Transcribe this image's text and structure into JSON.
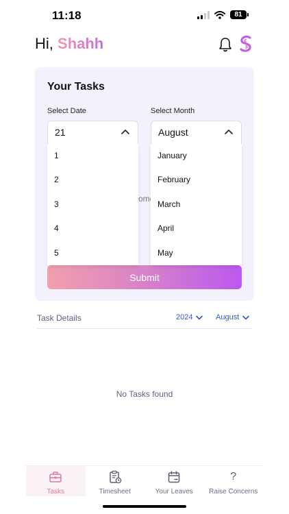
{
  "status_bar": {
    "time": "11:18",
    "battery": "81"
  },
  "header": {
    "greeting": "Hi,",
    "user_name": "Shahh"
  },
  "tasks_card": {
    "title": "Your Tasks",
    "date_label": "Select Date",
    "date_value": "21",
    "month_label": "Select Month",
    "month_value": "August",
    "behind_text": "ome",
    "submit_label": "Submit",
    "date_options": [
      "1",
      "2",
      "3",
      "4",
      "5"
    ],
    "month_options": [
      "January",
      "February",
      "March",
      "April",
      "May"
    ]
  },
  "task_details": {
    "label": "Task Details",
    "year_filter": "2024",
    "month_filter": "August",
    "empty_message": "No Tasks found"
  },
  "nav": {
    "items": [
      {
        "label": "Tasks",
        "icon": "briefcase-icon"
      },
      {
        "label": "Timesheet",
        "icon": "clipboard-clock-icon"
      },
      {
        "label": "Your Leaves",
        "icon": "calendar-icon"
      },
      {
        "label": "Raise Concerns",
        "icon": "question-icon",
        "glyph": "?"
      }
    ]
  },
  "colors": {
    "accent_blue": "#3458c6",
    "card_bg": "#f3f1fc",
    "gradient_start": "#f2a0ad",
    "gradient_end": "#bb58f0",
    "active_tab_bg": "#fbf2f6"
  }
}
